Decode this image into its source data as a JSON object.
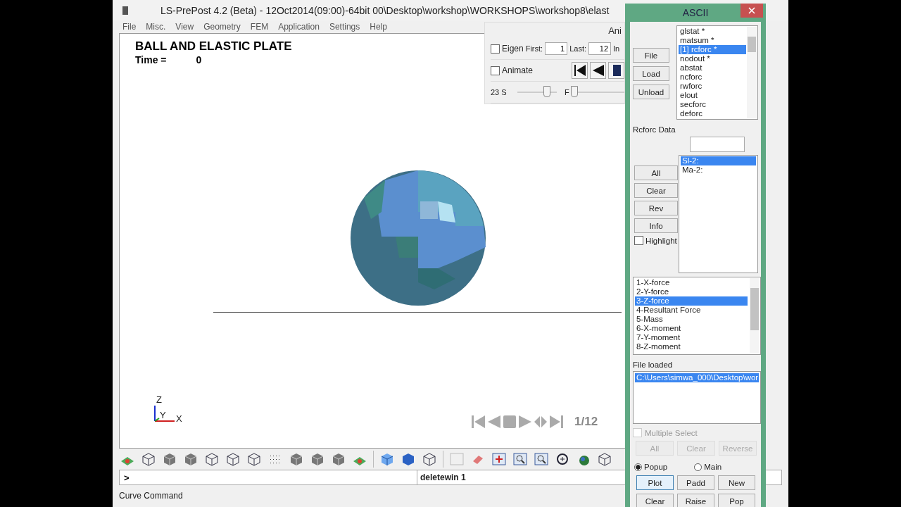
{
  "window": {
    "title": "LS-PrePost 4.2 (Beta) - 12Oct2014(09:00)-64bit 00\\Desktop\\workshop\\WORKSHOPS\\workshop8\\elast"
  },
  "menu": [
    "File",
    "Misc.",
    "View",
    "Geometry",
    "FEM",
    "Application",
    "Settings",
    "Help"
  ],
  "viewport": {
    "title": "BALL AND ELASTIC PLATE",
    "time_label": "Time =",
    "time_value": "0",
    "axis_z": "Z",
    "axis_y": "Y",
    "axis_x": "X",
    "frame": "1/12"
  },
  "anim_panel": {
    "title": "Ani",
    "eigen": {
      "label": "Eigen",
      "checked": false
    },
    "first_label": "First:",
    "first": "1",
    "last_label": "Last:",
    "last": "12",
    "inc_label": "In",
    "animate": {
      "label": "Animate",
      "checked": false
    },
    "speed_label": "23 S",
    "speed": {
      "level": 0.75
    },
    "frame_label": "F",
    "frame_slider": {
      "level": 0.05
    }
  },
  "command": {
    "prompt": ">",
    "history": "deletewin 1"
  },
  "status_bar": "Curve Command",
  "ascii": {
    "title": "ASCII",
    "file_buttons": [
      "File",
      "Load",
      "Unload"
    ],
    "files": [
      {
        "label": "glstat *",
        "selected": false
      },
      {
        "label": "matsum *",
        "selected": false
      },
      {
        "label": "[1] rcforc *",
        "selected": true
      },
      {
        "label": "nodout *",
        "selected": false
      },
      {
        "label": "abstat",
        "selected": false
      },
      {
        "label": "ncforc",
        "selected": false
      },
      {
        "label": "rwforc",
        "selected": false
      },
      {
        "label": "elout",
        "selected": false
      },
      {
        "label": "secforc",
        "selected": false
      },
      {
        "label": "deforc",
        "selected": false
      }
    ],
    "data_label": "Rcforc Data",
    "entities": [
      {
        "label": "Sl-2:",
        "selected": true
      },
      {
        "label": "Ma-2:",
        "selected": false
      }
    ],
    "entity_buttons": [
      "All",
      "Clear",
      "Rev",
      "Info"
    ],
    "highlight": {
      "label": "Highlight",
      "checked": false
    },
    "components": [
      {
        "label": "1-X-force",
        "selected": false
      },
      {
        "label": "2-Y-force",
        "selected": false
      },
      {
        "label": "3-Z-force",
        "selected": true
      },
      {
        "label": "4-Resultant Force",
        "selected": false
      },
      {
        "label": "5-Mass",
        "selected": false
      },
      {
        "label": "6-X-moment",
        "selected": false
      },
      {
        "label": "7-Y-moment",
        "selected": false
      },
      {
        "label": "8-Z-moment",
        "selected": false
      }
    ],
    "file_loaded_label": "File loaded",
    "loaded_files": [
      {
        "label": "C:\\Users\\simwa_000\\Desktop\\wor",
        "selected": true
      }
    ],
    "multiple_select": {
      "label": "Multiple Select",
      "checked": false,
      "disabled": true
    },
    "select_buttons": [
      {
        "label": "All",
        "disabled": true
      },
      {
        "label": "Clear",
        "disabled": true
      },
      {
        "label": "Reverse",
        "disabled": true
      }
    ],
    "plot_target": [
      {
        "label": "Popup",
        "selected": true
      },
      {
        "label": "Main",
        "selected": false
      }
    ],
    "action_buttons": [
      "Plot",
      "Padd",
      "New",
      "Clear",
      "Raise",
      "Pop"
    ]
  }
}
